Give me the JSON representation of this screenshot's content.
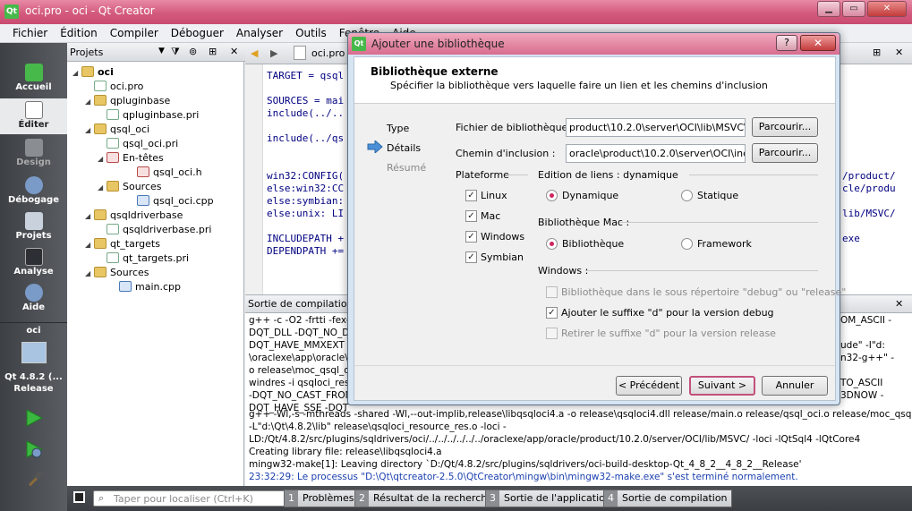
{
  "window": {
    "title": "oci.pro - oci - Qt Creator",
    "app_icon": "Qt"
  },
  "menu": [
    "Fichier",
    "Édition",
    "Compiler",
    "Déboguer",
    "Analyser",
    "Outils",
    "Fenêtre",
    "Aide"
  ],
  "modes": [
    {
      "label": "Accueil",
      "icon": "qt-logo-icon"
    },
    {
      "label": "Éditer",
      "icon": "edit-icon"
    },
    {
      "label": "Design",
      "icon": "design-icon"
    },
    {
      "label": "Débogage",
      "icon": "debug-icon"
    },
    {
      "label": "Projets",
      "icon": "projects-icon"
    },
    {
      "label": "Analyse",
      "icon": "analyze-icon"
    },
    {
      "label": "Aide",
      "icon": "help-icon"
    }
  ],
  "target": {
    "project": "oci",
    "kit": "Qt 4.8.2 (...",
    "config": "Release"
  },
  "projects_pane": {
    "title": "Projets",
    "tree": [
      {
        "label": "oci",
        "type": "folder",
        "depth": 0,
        "bold": true
      },
      {
        "label": "oci.pro",
        "type": "pro",
        "depth": 1
      },
      {
        "label": "qpluginbase",
        "type": "folder",
        "depth": 1
      },
      {
        "label": "qpluginbase.pri",
        "type": "pro",
        "depth": 2
      },
      {
        "label": "qsql_oci",
        "type": "folder",
        "depth": 1
      },
      {
        "label": "qsql_oci.pri",
        "type": "pro",
        "depth": 2
      },
      {
        "label": "En-têtes",
        "type": "h",
        "depth": 2
      },
      {
        "label": "qsql_oci.h",
        "type": "h",
        "depth": 3
      },
      {
        "label": "Sources",
        "type": "folder",
        "depth": 2
      },
      {
        "label": "qsql_oci.cpp",
        "type": "cpp",
        "depth": 3
      },
      {
        "label": "qsqldriverbase",
        "type": "folder",
        "depth": 1
      },
      {
        "label": "qsqldriverbase.pri",
        "type": "pro",
        "depth": 2
      },
      {
        "label": "qt_targets",
        "type": "folder",
        "depth": 1
      },
      {
        "label": "qt_targets.pri",
        "type": "pro",
        "depth": 2
      },
      {
        "label": "Sources",
        "type": "folder",
        "depth": 1
      },
      {
        "label": "main.cpp",
        "type": "cpp",
        "depth": 2
      }
    ]
  },
  "editor": {
    "file": "oci.pro",
    "lines": [
      "TARGET = qsql",
      "",
      "SOURCES = mai",
      "include(../..",
      "",
      "include(../qs",
      "",
      "",
      "win32:CONFIG(",
      "else:win32:CC",
      "else:symbian:",
      "else:unix: LI",
      "",
      "INCLUDEPATH +",
      "DEPENDPATH +="
    ],
    "right_fragments": [
      "/product/",
      "cle/produ",
      "lib/MSVC/",
      "exe"
    ]
  },
  "output": {
    "title": "Sortie de compilation",
    "lines": [
      {
        "text": "g++ -c -O2 -frtti -fexc",
        "right": "OM_ASCII -"
      },
      {
        "text": "DQT_DLL -DQT_NO_DE",
        "right": ""
      },
      {
        "text": "DQT_HAVE_MMXEXT -D",
        "right": "ude\" -I\"d:"
      },
      {
        "text": "\\oraclexe\\app\\oracle\\p",
        "right": "n32-g++\" -"
      },
      {
        "text": "o release\\moc_qsql_oc",
        "right": ""
      },
      {
        "text": "windres -i qsqloci_resou",
        "right": "TO_ASCII"
      },
      {
        "text": "-DQT_NO_CAST_FROM",
        "right": "3DNOW -"
      },
      {
        "text": "DQT_HAVE_SSE -DQT",
        "right": ""
      },
      {
        "text": "g++ -Wl,-s -mthreads -shared -Wl,--out-implib,release\\libqsqloci4.a -o release\\qsqloci4.dll release/main.o release/qsql_oci.o release/moc_qsql_oci.o",
        "right": ""
      },
      {
        "text": "-L\"d:\\Qt\\4.8.2\\lib\" release\\qsqloci_resource_res.o -loci -",
        "right": ""
      },
      {
        "text": "LD:/Qt/4.8.2/src/plugins/sqldrivers/oci/../../../../../../oraclexe/app/oracle/product/10.2.0/server/OCI/lib/MSVC/ -loci -lQtSql4 -lQtCore4",
        "right": ""
      },
      {
        "text": "Creating library file: release\\libqsqloci4.a",
        "right": ""
      },
      {
        "text": "mingw32-make[1]: Leaving directory `D:/Qt/4.8.2/src/plugins/sqldrivers/oci-build-desktop-Qt_4_8_2__4_8_2__Release'",
        "right": ""
      },
      {
        "text": "23:32:29: Le processus \"D:\\Qt\\qtcreator-2.5.0\\QtCreator\\mingw\\bin\\mingw32-make.exe\" s'est terminé normalement.",
        "right": "",
        "blue": true
      }
    ]
  },
  "statusbar": {
    "locator_placeholder": "Taper pour localiser (Ctrl+K)",
    "panes": [
      {
        "num": "1",
        "label": "Problèmes"
      },
      {
        "num": "2",
        "label": "Résultat de la recherche"
      },
      {
        "num": "3",
        "label": "Sortie de l'application"
      },
      {
        "num": "4",
        "label": "Sortie de compilation"
      }
    ]
  },
  "dialog": {
    "title": "Ajouter une bibliothèque",
    "help_label": "?",
    "close_label": "✕",
    "heading": "Bibliothèque externe",
    "subheading": "Spécifier la bibliothèque vers laquelle faire un lien et les chemins d'inclusion",
    "steps": [
      {
        "label": "Type",
        "state": "done"
      },
      {
        "label": "Détails",
        "state": "current"
      },
      {
        "label": "Résumé",
        "state": "pending"
      }
    ],
    "library_file_label": "Fichier de bibliothèque :",
    "library_file_value": "product\\10.2.0\\server\\OCI\\lib\\MSVC\\oci.lib",
    "include_path_label": "Chemin d'inclusion :",
    "include_path_value": "oracle\\product\\10.2.0\\server\\OCI\\include",
    "browse_label": "Parcourir...",
    "platform_label": "Plateforme",
    "platforms": [
      {
        "label": "Linux",
        "checked": true
      },
      {
        "label": "Mac",
        "checked": true
      },
      {
        "label": "Windows",
        "checked": true
      },
      {
        "label": "Symbian",
        "checked": true
      }
    ],
    "linking_label": "Edition de liens : dynamique",
    "linking_options": [
      {
        "label": "Dynamique",
        "selected": true
      },
      {
        "label": "Statique",
        "selected": false
      }
    ],
    "mac_label": "Bibliothèque Mac :",
    "mac_options": [
      {
        "label": "Bibliothèque",
        "selected": true
      },
      {
        "label": "Framework",
        "selected": false
      }
    ],
    "windows_label": "Windows :",
    "windows_options": [
      {
        "label": "Bibliothèque dans le sous répertoire \"debug\" ou \"release\"",
        "checked": false,
        "enabled": false
      },
      {
        "label": "Ajouter le suffixe \"d\" pour la version debug",
        "checked": true,
        "enabled": true
      },
      {
        "label": "Retirer le suffixe \"d\" pour la version release",
        "checked": false,
        "enabled": false
      }
    ],
    "back_label": "< Précédent",
    "next_label": "Suivant >",
    "cancel_label": "Annuler"
  }
}
